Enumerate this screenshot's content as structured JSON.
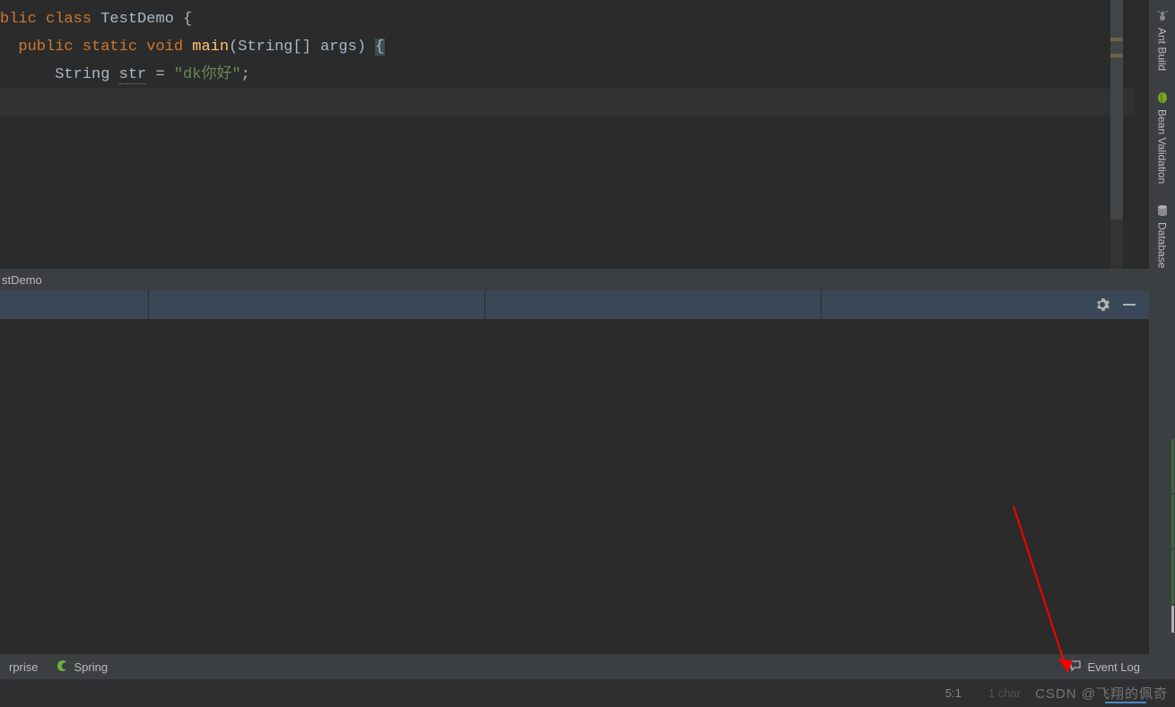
{
  "editor": {
    "tab_label": "stDemo",
    "code": {
      "line1_prefix": "blic",
      "kw_class": "class",
      "class_name": "TestDemo",
      "brace_open": "{",
      "kw_public": "public",
      "kw_static": "static",
      "kw_void": "void",
      "method": "main",
      "params_open": "(",
      "param_type": "String[]",
      "param_name": "args",
      "params_close": ")",
      "body_open": "{",
      "var_type": "String",
      "var_name": "str",
      "eq": "=",
      "string_val": "\"dk你好\"",
      "semi": ";",
      "body_close": "}"
    },
    "cursor": "5:1"
  },
  "right_tools": [
    {
      "id": "ant-build",
      "label": "Ant Build"
    },
    {
      "id": "bean-validation",
      "label": "Bean Validation"
    },
    {
      "id": "database",
      "label": "Database"
    }
  ],
  "bottom_tools": {
    "enterprise": "rprise",
    "spring": "Spring",
    "event_log": "Event Log"
  },
  "status": {
    "position": "5:1",
    "extra": "1 char"
  },
  "watermark": "CSDN @飞翔的佩奇"
}
